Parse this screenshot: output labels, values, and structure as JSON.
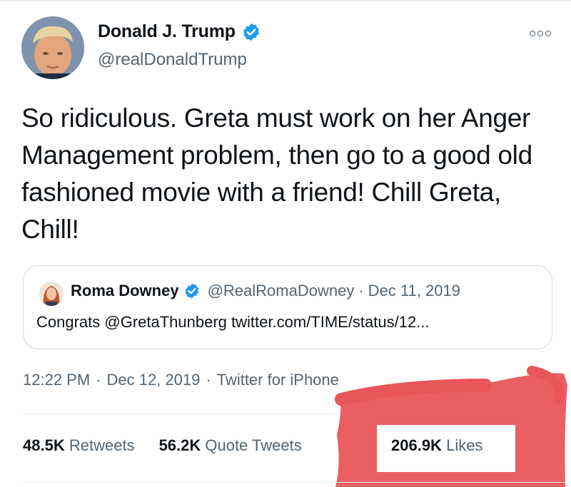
{
  "tweet": {
    "author": {
      "display_name": "Donald J. Trump",
      "handle": "@realDonaldTrump",
      "verified": true
    },
    "more_icon": "more-horizontal-icon",
    "text": "So ridiculous. Greta must work on her Anger Management problem, then go to a good old fashioned movie with a friend! Chill Greta, Chill!",
    "quote": {
      "display_name": "Roma Downey",
      "verified": true,
      "handle": "@RealRomaDowney",
      "separator": "·",
      "date": "Dec 11, 2019",
      "text": "Congrats @GretaThunberg twitter.com/TIME/status/12..."
    },
    "meta": {
      "time": "12:22 PM",
      "separator": "·",
      "date": "Dec 12, 2019",
      "source": "Twitter for iPhone"
    },
    "stats": {
      "retweets_count": "48.5K",
      "retweets_label": "Retweets",
      "quotes_count": "56.2K",
      "quotes_label": "Quote Tweets",
      "likes_count": "206.9K",
      "likes_label": "Likes"
    }
  },
  "colors": {
    "verified_blue": "#1d9bf0",
    "text_primary": "#0f1419",
    "text_secondary": "#536471",
    "highlight_red": "#e8565a"
  }
}
